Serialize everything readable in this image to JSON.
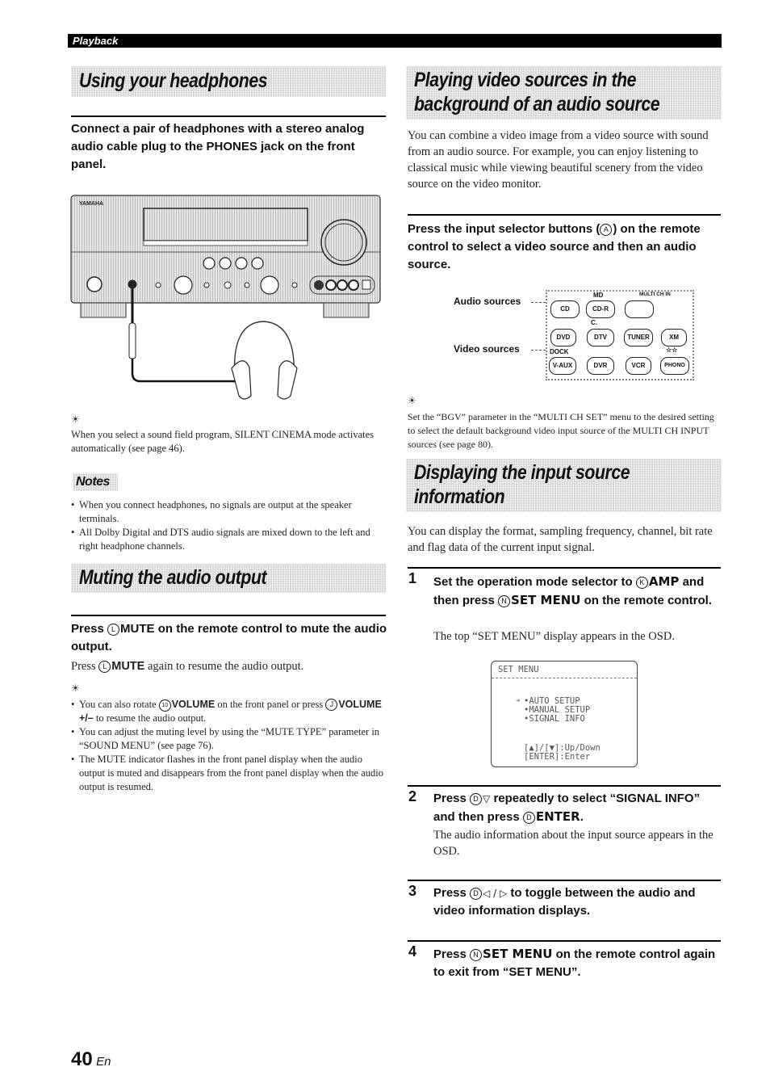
{
  "header": {
    "section": "Playback"
  },
  "left": {
    "headphones": {
      "title": "Using your headphones",
      "lead": "Connect a pair of headphones with a stereo analog audio cable plug to the PHONES jack on the front panel.",
      "figure_brand": "YAMAHA",
      "tip_icon": "lightbulb-tip-icon",
      "tip": "When you select a sound field program, SILENT CINEMA mode activates automatically (see page 46).",
      "notes_label": "Notes",
      "notes": [
        "When you connect headphones, no signals are output at the speaker terminals.",
        "All Dolby Digital and DTS audio signals are mixed down to the left and right headphone channels."
      ]
    },
    "muting": {
      "title": "Muting the audio output",
      "lead_pre": "Press ",
      "lead_key": "L",
      "lead_bold": "MUTE",
      "lead_post": " on the remote control to mute the audio output.",
      "body_pre": "Press ",
      "body_key": "L",
      "body_bold": "MUTE",
      "body_post": " again to resume the audio output.",
      "tips": [
        {
          "pre": "You can also rotate ",
          "key": "10",
          "bold": "VOLUME",
          "mid": " on the front panel or press ",
          "key2": "J",
          "bold2": "VOLUME +/–",
          "post": " to resume the audio output."
        },
        {
          "text": "You can adjust the muting level by using the “MUTE TYPE” parameter in “SOUND MENU” (see page 76)."
        },
        {
          "text": "The MUTE indicator flashes in the front panel display when the audio output is muted and disappears from the front panel display when the audio output is resumed."
        }
      ]
    }
  },
  "right": {
    "background": {
      "title_line1": "Playing video sources in the",
      "title_line2": "background of an audio source",
      "body": "You can combine a video image from a video source with sound from an audio source. For example, you can enjoy listening to classical music while viewing beautiful scenery from the video source on the video monitor.",
      "lead_pre": "Press the input selector buttons (",
      "lead_key": "A",
      "lead_post": ") on the remote control to select a video source and then an audio source.",
      "figure": {
        "audio_label": "Audio sources",
        "video_label": "Video sources",
        "top_labels": [
          "MD",
          "MULTI CH IN"
        ],
        "buttons": [
          "CD",
          "CD-R",
          "",
          "DVD",
          "DTV",
          "TUNER",
          "XM",
          "V-AUX",
          "DVR",
          "VCR",
          "PHONO"
        ],
        "dock_label": "DOCK",
        "star_label": "☆☆",
        "c_label": "C."
      },
      "tip": "Set the “BGV” parameter in the “MULTI CH SET” menu to the desired setting to select the default background video input source of the MULTI CH INPUT sources (see page 80)."
    },
    "display_info": {
      "title_line1": "Displaying the input source",
      "title_line2": "information",
      "body": "You can display the format, sampling frequency, channel, bit rate and flag data of the current input signal.",
      "steps": [
        {
          "num": "1",
          "t1": "Set the operation mode selector to ",
          "k1": "K",
          "b1": "AMP",
          "t2": " and then press ",
          "k2": "N",
          "b2": "SET MENU",
          "t3": " on the remote control.",
          "body": "The top “SET MENU” display appears in the OSD."
        },
        {
          "num": "2",
          "t1": "Press ",
          "k1": "D",
          "b1": "▽",
          "t2": " repeatedly to select “SIGNAL INFO” and then press ",
          "k2": "D",
          "b2": "ENTER",
          "t3": ".",
          "body": "The audio information about the input source appears in the OSD."
        },
        {
          "num": "3",
          "t1": "Press ",
          "k1": "D",
          "b1": "◁ / ▷",
          "t2": " to toggle between the audio and video information displays."
        },
        {
          "num": "4",
          "t1": "Press ",
          "k1": "N",
          "b1": "SET MENU",
          "t2": " on the remote control again to exit from “SET MENU”."
        }
      ],
      "osd": {
        "title": "SET MENU",
        "cursor": "➔",
        "items": [
          "•AUTO SETUP",
          "•MANUAL SETUP",
          "•SIGNAL INFO"
        ],
        "help": [
          "[▲]/[▼]:Up/Down",
          "[ENTER]:Enter"
        ]
      }
    }
  },
  "footer": {
    "page": "40",
    "lang": "En"
  }
}
